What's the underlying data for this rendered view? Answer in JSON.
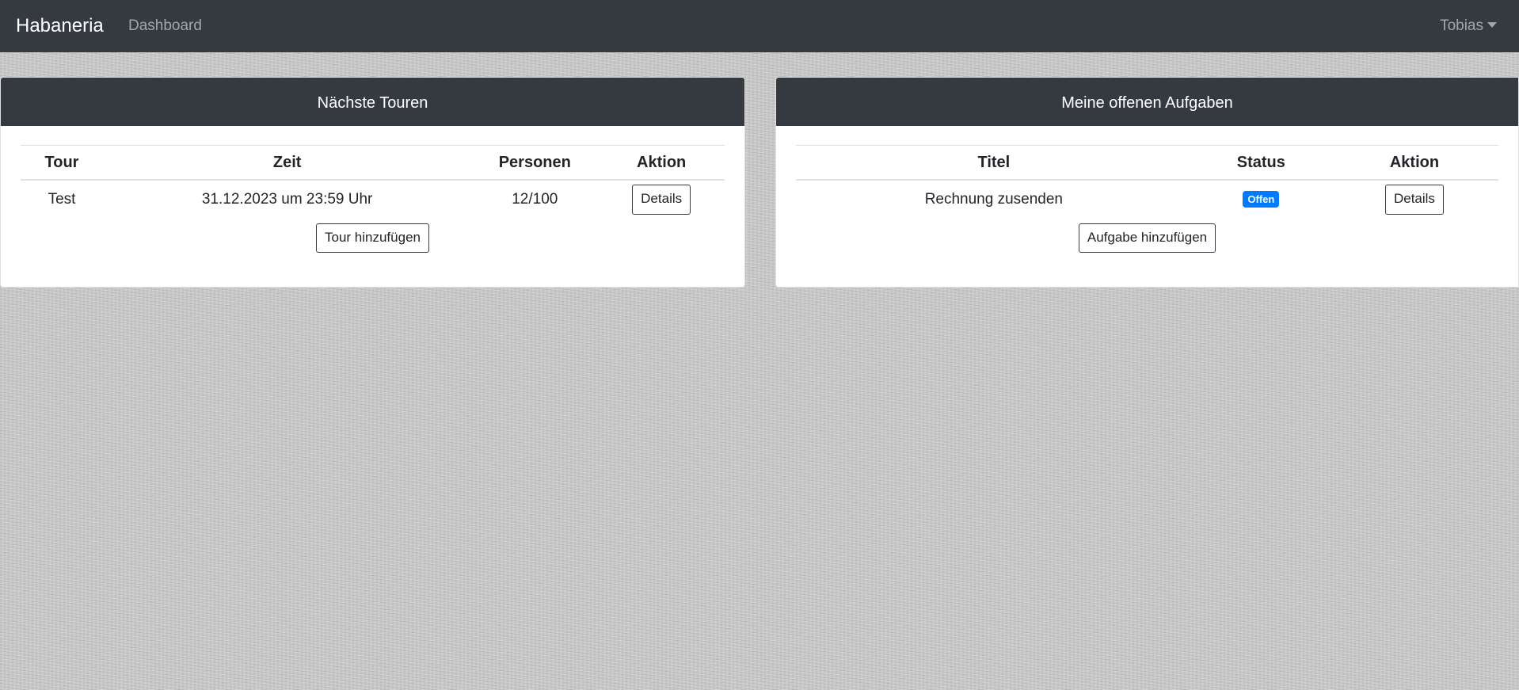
{
  "navbar": {
    "brand": "Habaneria",
    "links": [
      "Dashboard"
    ],
    "user": "Tobias"
  },
  "tours_card": {
    "title": "Nächste Touren",
    "columns": [
      "Tour",
      "Zeit",
      "Personen",
      "Aktion"
    ],
    "rows": [
      {
        "tour": "Test",
        "zeit": "31.12.2023 um 23:59 Uhr",
        "personen": "12/100",
        "action_label": "Details"
      }
    ],
    "add_button": "Tour hinzufügen"
  },
  "tasks_card": {
    "title": "Meine offenen Aufgaben",
    "columns": [
      "Titel",
      "Status",
      "Aktion"
    ],
    "rows": [
      {
        "titel": "Rechnung zusenden",
        "status": "Offen",
        "action_label": "Details"
      }
    ],
    "add_button": "Aufgabe hinzufügen"
  },
  "colors": {
    "navbar": "#343a40",
    "status_badge": "#007bff"
  }
}
